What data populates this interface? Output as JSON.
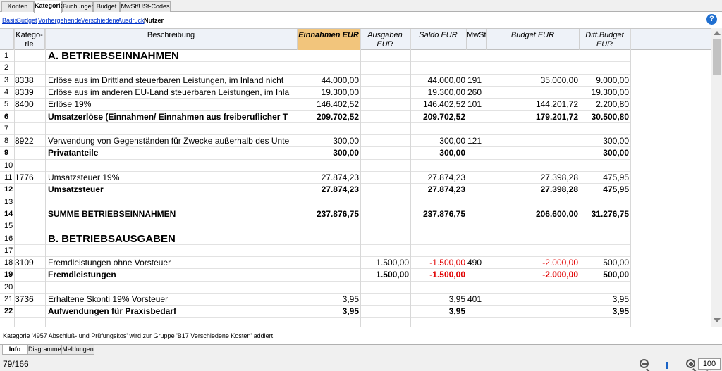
{
  "top_tabs": [
    {
      "label": "Konten",
      "active": false
    },
    {
      "label": "Kategorien",
      "active": true
    },
    {
      "label": "Buchungen",
      "active": false
    },
    {
      "label": "Budget",
      "active": false
    },
    {
      "label": "MwSt/USt-Codes",
      "active": false
    }
  ],
  "sub_nav": [
    {
      "label": "Basis",
      "active": false
    },
    {
      "label": "Budget",
      "active": false
    },
    {
      "label": "Vorhergehende",
      "active": false
    },
    {
      "label": "Verschiedene",
      "active": false
    },
    {
      "label": "Ausdruck",
      "active": false
    },
    {
      "label": "Nutzer",
      "active": true
    }
  ],
  "help_icon": "?",
  "columns": {
    "kategorie": "Katego-rie",
    "beschreibung": "Beschreibung",
    "einnahmen": "Einnahmen EUR",
    "ausgaben": "Ausgaben EUR",
    "saldo": "Saldo EUR",
    "mwst": "MwSt/USt-",
    "budget": "Budget EUR",
    "diff": "Diff.Budget EUR"
  },
  "rows": [
    {
      "n": "1",
      "cat": "",
      "desc": "A. BETRIEBSEINNAHMEN",
      "ein": "",
      "aus": "",
      "sal": "",
      "mw": "",
      "bud": "",
      "dif": "",
      "style": "big"
    },
    {
      "n": "2",
      "cat": "",
      "desc": "",
      "ein": "",
      "aus": "",
      "sal": "",
      "mw": "",
      "bud": "",
      "dif": "",
      "style": ""
    },
    {
      "n": "3",
      "cat": "8338",
      "desc": "Erlöse aus im Drittland steuerbaren Leistungen, im Inland nicht",
      "ein": "44.000,00",
      "aus": "",
      "sal": "44.000,00",
      "mw": "191",
      "bud": "35.000,00",
      "dif": "9.000,00",
      "style": ""
    },
    {
      "n": "4",
      "cat": "8339",
      "desc": "Erlöse aus im anderen EU-Land steuerbaren Leistungen, im Inla",
      "ein": "19.300,00",
      "aus": "",
      "sal": "19.300,00",
      "mw": "260",
      "bud": "",
      "dif": "19.300,00",
      "style": ""
    },
    {
      "n": "5",
      "cat": "8400",
      "desc": "Erlöse 19%",
      "ein": "146.402,52",
      "aus": "",
      "sal": "146.402,52",
      "mw": "101",
      "bud": "144.201,72",
      "dif": "2.200,80",
      "style": ""
    },
    {
      "n": "6",
      "cat": "",
      "desc": "Umsatzerlöse (Einnahmen/ Einnahmen aus freiberuflicher T",
      "ein": "209.702,52",
      "aus": "",
      "sal": "209.702,52",
      "mw": "",
      "bud": "179.201,72",
      "dif": "30.500,80",
      "style": "bold"
    },
    {
      "n": "7",
      "cat": "",
      "desc": "",
      "ein": "",
      "aus": "",
      "sal": "",
      "mw": "",
      "bud": "",
      "dif": "",
      "style": ""
    },
    {
      "n": "8",
      "cat": "8922",
      "desc": "Verwendung von Gegenständen für Zwecke außerhalb des Unte",
      "ein": "300,00",
      "aus": "",
      "sal": "300,00",
      "mw": "121",
      "bud": "",
      "dif": "300,00",
      "style": ""
    },
    {
      "n": "9",
      "cat": "",
      "desc": "Privatanteile",
      "ein": "300,00",
      "aus": "",
      "sal": "300,00",
      "mw": "",
      "bud": "",
      "dif": "300,00",
      "style": "bold"
    },
    {
      "n": "10",
      "cat": "",
      "desc": "",
      "ein": "",
      "aus": "",
      "sal": "",
      "mw": "",
      "bud": "",
      "dif": "",
      "style": ""
    },
    {
      "n": "11",
      "cat": "1776",
      "desc": "Umsatzsteuer 19%",
      "ein": "27.874,23",
      "aus": "",
      "sal": "27.874,23",
      "mw": "",
      "bud": "27.398,28",
      "dif": "475,95",
      "style": ""
    },
    {
      "n": "12",
      "cat": "",
      "desc": "Umsatzsteuer",
      "ein": "27.874,23",
      "aus": "",
      "sal": "27.874,23",
      "mw": "",
      "bud": "27.398,28",
      "dif": "475,95",
      "style": "bold"
    },
    {
      "n": "13",
      "cat": "",
      "desc": "",
      "ein": "",
      "aus": "",
      "sal": "",
      "mw": "",
      "bud": "",
      "dif": "",
      "style": ""
    },
    {
      "n": "14",
      "cat": "",
      "desc": "SUMME BETRIEBSEINNAHMEN",
      "ein": "237.876,75",
      "aus": "",
      "sal": "237.876,75",
      "mw": "",
      "bud": "206.600,00",
      "dif": "31.276,75",
      "style": "bold"
    },
    {
      "n": "15",
      "cat": "",
      "desc": "",
      "ein": "",
      "aus": "",
      "sal": "",
      "mw": "",
      "bud": "",
      "dif": "",
      "style": ""
    },
    {
      "n": "16",
      "cat": "",
      "desc": "B. BETRIEBSAUSGABEN",
      "ein": "",
      "aus": "",
      "sal": "",
      "mw": "",
      "bud": "",
      "dif": "",
      "style": "big"
    },
    {
      "n": "17",
      "cat": "",
      "desc": "",
      "ein": "",
      "aus": "",
      "sal": "",
      "mw": "",
      "bud": "",
      "dif": "",
      "style": ""
    },
    {
      "n": "18",
      "cat": "3109",
      "desc": "Fremdleistungen ohne Vorsteuer",
      "ein": "",
      "aus": "1.500,00",
      "sal": "-1.500,00",
      "mw": "490",
      "bud": "-2.000,00",
      "dif": "500,00",
      "style": ""
    },
    {
      "n": "19",
      "cat": "",
      "desc": "Fremdleistungen",
      "ein": "",
      "aus": "1.500,00",
      "sal": "-1.500,00",
      "mw": "",
      "bud": "-2.000,00",
      "dif": "500,00",
      "style": "bold"
    },
    {
      "n": "20",
      "cat": "",
      "desc": "",
      "ein": "",
      "aus": "",
      "sal": "",
      "mw": "",
      "bud": "",
      "dif": "",
      "style": ""
    },
    {
      "n": "21",
      "cat": "3736",
      "desc": "Erhaltene Skonti 19% Vorsteuer",
      "ein": "3,95",
      "aus": "",
      "sal": "3,95",
      "mw": "401",
      "bud": "",
      "dif": "3,95",
      "style": ""
    },
    {
      "n": "22",
      "cat": "",
      "desc": "Aufwendungen für Praxisbedarf",
      "ein": "3,95",
      "aus": "",
      "sal": "3,95",
      "mw": "",
      "bud": "",
      "dif": "3,95",
      "style": "bold"
    },
    {
      "n": "",
      "cat": "",
      "desc": "",
      "ein": "",
      "aus": "",
      "sal": "",
      "mw": "",
      "bud": "",
      "dif": "",
      "style": ""
    }
  ],
  "info_message": "Kategorie '4957 Abschluß- und Prüfungskos' wird zur Gruppe 'B17 Verschiedene Kosten' addiert",
  "bottom_tabs": [
    {
      "label": "Info",
      "active": true
    },
    {
      "label": "Diagramme",
      "active": false
    },
    {
      "label": "Meldungen",
      "active": false
    }
  ],
  "status": {
    "count": "79/166",
    "zoom": "100 %"
  },
  "colors": {
    "negative": "#e00000",
    "highlight_header": "#f2c57c",
    "link": "#0033cc",
    "help": "#1f6fd0"
  }
}
